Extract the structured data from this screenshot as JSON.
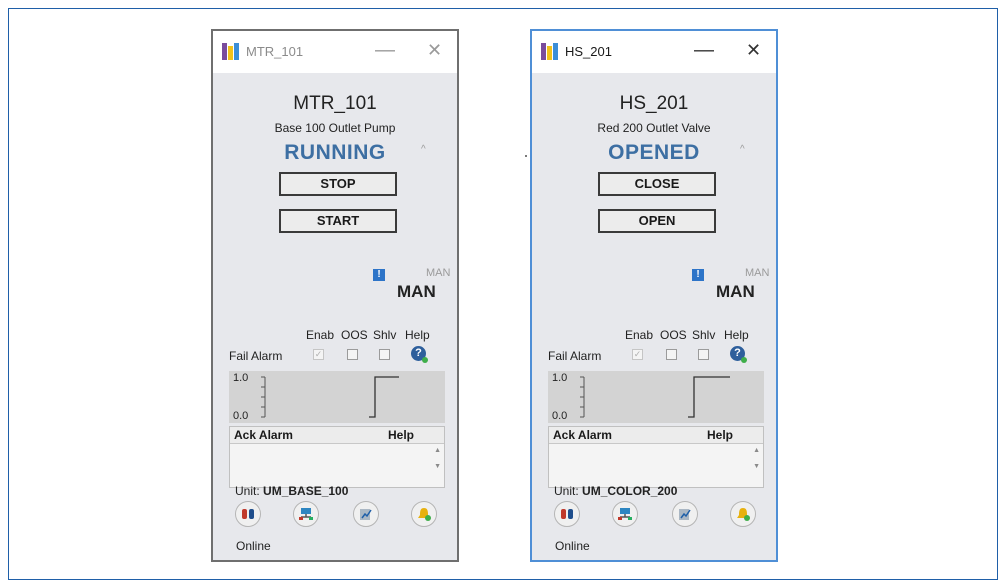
{
  "faceplates": [
    {
      "window_title": "MTR_101",
      "tag": "MTR_101",
      "description": "Base 100 Outlet Pump",
      "state": "RUNNING",
      "button_1": "STOP",
      "button_2": "START",
      "mode_requested": "MAN",
      "mode_actual": "MAN",
      "alarm_headers": {
        "enab": "Enab",
        "oos": "OOS",
        "shlv": "Shlv",
        "help": "Help"
      },
      "alarm_label": "Fail Alarm",
      "trend": {
        "y_max": "1.0",
        "y_min": "0.0"
      },
      "alarm_list": {
        "ack": "Ack Alarm",
        "help": "Help"
      },
      "unit_label": "Unit:",
      "unit_value": "UM_BASE_100",
      "status": "Online"
    },
    {
      "window_title": "HS_201",
      "tag": "HS_201",
      "description": "Red 200 Outlet Valve",
      "state": "OPENED",
      "button_1": "CLOSE",
      "button_2": "OPEN",
      "mode_requested": "MAN",
      "mode_actual": "MAN",
      "alarm_headers": {
        "enab": "Enab",
        "oos": "OOS",
        "shlv": "Shlv",
        "help": "Help"
      },
      "alarm_label": "Fail Alarm",
      "trend": {
        "y_max": "1.0",
        "y_min": "0.0"
      },
      "alarm_list": {
        "ack": "Ack Alarm",
        "help": "Help"
      },
      "unit_label": "Unit:",
      "unit_value": "UM_COLOR_200",
      "status": "Online"
    }
  ],
  "window_controls": {
    "minimize": "—",
    "close": "✕"
  },
  "colors": {
    "state": "#3d6fa3",
    "active_border": "#4f8fd6",
    "inactive_border": "#6f6f6f"
  },
  "icons": [
    "app-icon",
    "minimize-icon",
    "close-icon",
    "caret-up-icon",
    "alert-icon",
    "help-icon",
    "equipment-icon",
    "network-icon",
    "trend-icon",
    "alarm-bell-icon"
  ]
}
